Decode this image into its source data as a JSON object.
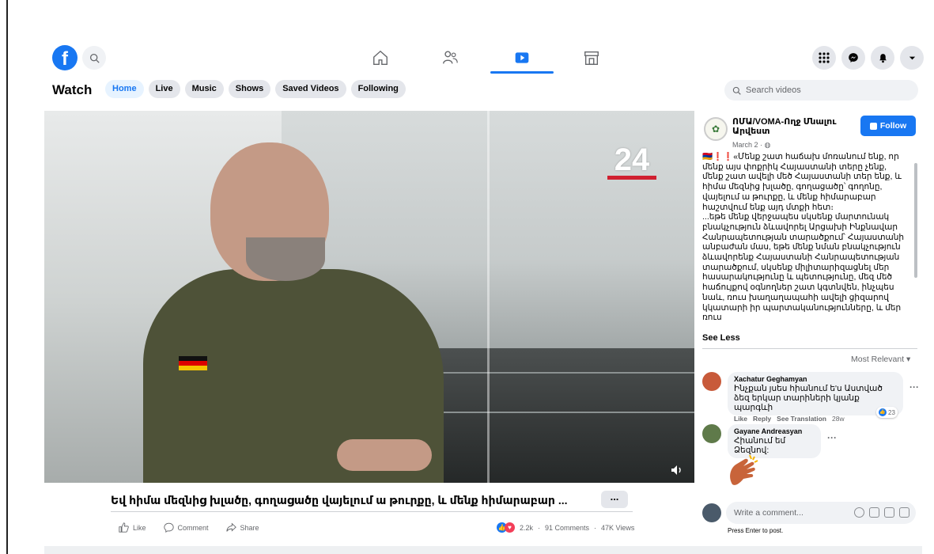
{
  "nav": {
    "search_icon": "search-icon",
    "home_icon": "home-icon",
    "friends_icon": "friends-icon",
    "watch_icon": "watch-icon",
    "marketplace_icon": "marketplace-icon",
    "menu_icon": "grid-menu-icon",
    "messenger_icon": "messenger-icon",
    "notifications_icon": "bell-icon",
    "account_icon": "chevron-down-icon"
  },
  "watch": {
    "title": "Watch",
    "tabs": [
      "Home",
      "Live",
      "Music",
      "Shows",
      "Saved Videos",
      "Following"
    ],
    "active_tab": "Home",
    "search_placeholder": "Search videos"
  },
  "video": {
    "channel_logo": "24",
    "caption": "Եվ հիմա մեզնից խլածը, գողացածը վայելում ա թուրքը, և մենք հիմարաբար ...",
    "more_label": "...",
    "actions": {
      "like": "Like",
      "comment": "Comment",
      "share": "Share"
    },
    "stats": {
      "reactions": "2.2k",
      "comments": "91 Comments",
      "views": "47K Views"
    }
  },
  "post": {
    "page_name": "ՈՄԱ/VOMA-Ողջ Մնալու Արվեստ",
    "date": "March 2 · ",
    "follow_label": "Follow",
    "text": "🇦🇲❗❗«Մենք շատ հաճախ մոռանում ենք, որ մենք այս փոքրիկ Հայաստանի տերը չենք, մենք շատ ավելի մեծ Հայաստանի տեր ենք, և հիմա մեզնից խլածը, գողացածը՝ գողոնը, վայելում ա թուրքը, և մենք հիմարաբար հաշտվում ենք այդ մտքի հետ։\n...եթե մենք վերջապես սկսենք մարտունակ բնակչություն ձևավորել Արցախի Ինքնավար Հանրապետության տարածքում՝ Հայաստանի անբաժան մաս, եթե մենք նման բնակչություն ձևավորենք Հայաստանի Հանրապետության տարածքում, սկսենք միլիտարիզացնել մեր հասարակությունը և պետությունը, մեզ մեծ հաճույքով օգնողներ շատ կգտնվեն, ինչպես նաև, ռուս խաղաղապահի ավելի ցիզարով կկատարի իր պարտականությունները, և մեր ռուս",
    "see_less": "See Less",
    "sort_label": "Most Relevant"
  },
  "comments": [
    {
      "author": "Xachatur Geghamyan",
      "text": "Ինչքան յսես հիանում ե'ս Աստված ձեզ երկար տարիների կյանք պարգևի",
      "like": "Like",
      "reply": "Reply",
      "see_translation": "See Translation",
      "time": "28w",
      "reactions": "23"
    },
    {
      "author": "Gayane Andreasyan",
      "text": "Հիանում եմ Ձեզնով:"
    }
  ],
  "write_comment": {
    "placeholder": "Write a comment...",
    "hint": "Press Enter to post."
  },
  "colors": {
    "accent": "#1877f2",
    "like_reaction": "#1877f2",
    "love_reaction": "#f33e58"
  }
}
